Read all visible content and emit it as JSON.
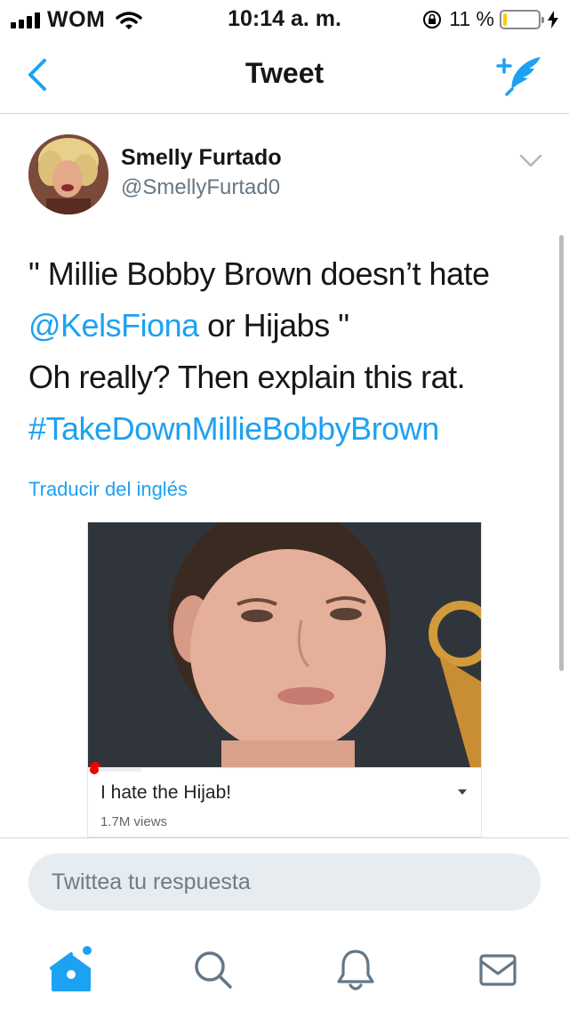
{
  "status_bar": {
    "carrier": "WOM",
    "time": "10:14 a. m.",
    "battery_percent": "11 %",
    "battery_level": 0.11
  },
  "nav": {
    "title": "Tweet",
    "back_icon": "chevron-left-icon",
    "compose_icon": "compose-tweet-icon"
  },
  "tweet": {
    "author_name": "Smelly Furtado",
    "author_handle": "@SmellyFurtad0",
    "text_line1": "\" Millie Bobby Brown doesn’t hate",
    "mention": "@KelsFiona",
    "text_line2_rest": " or Hijabs \"",
    "text_line3": "Oh really? Then explain this rat.",
    "hashtag": "#TakeDownMillieBobbyBrown",
    "translate_label": "Traducir del inglés",
    "media": {
      "video_title": "I hate the Hijab!",
      "video_views": "1.7M views"
    }
  },
  "reply": {
    "placeholder": "Twittea tu respuesta"
  },
  "tab_bar": {
    "items": [
      {
        "name": "home",
        "icon": "home-icon",
        "active": true
      },
      {
        "name": "search",
        "icon": "search-icon",
        "active": false
      },
      {
        "name": "notifications",
        "icon": "bell-icon",
        "active": false
      },
      {
        "name": "messages",
        "icon": "mail-icon",
        "active": false
      }
    ]
  },
  "colors": {
    "accent": "#1da1f2",
    "secondary_text": "#657786",
    "reply_bg": "#e6ecf0"
  }
}
